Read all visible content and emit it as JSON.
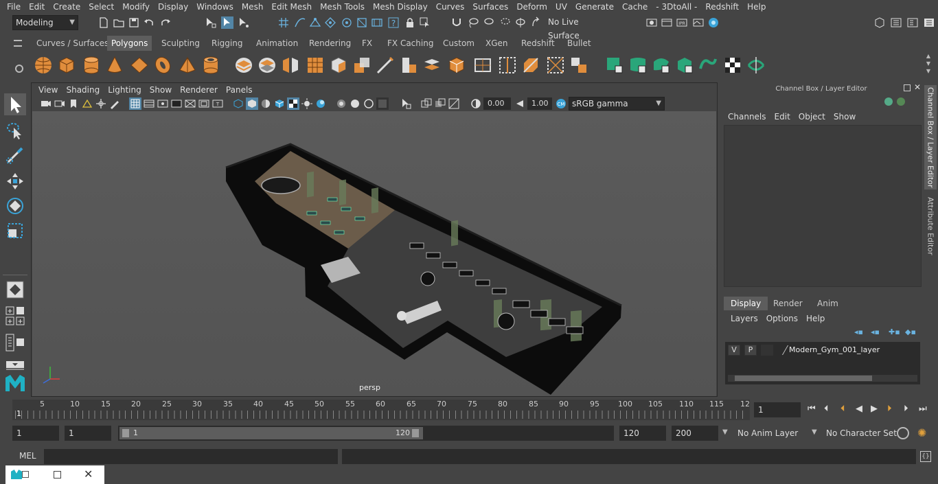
{
  "menubar": {
    "items": [
      "File",
      "Edit",
      "Create",
      "Select",
      "Modify",
      "Display",
      "Windows",
      "Mesh",
      "Edit Mesh",
      "Mesh Tools",
      "Mesh Display",
      "Curves",
      "Surfaces",
      "Deform",
      "UV",
      "Generate",
      "Cache",
      "- 3DtoAll -",
      "Redshift",
      "Help"
    ]
  },
  "statusline": {
    "mode": "Modeling",
    "live_surface": "No Live Surface"
  },
  "shelf": {
    "tabs": [
      "Curves / Surfaces",
      "Polygons",
      "Sculpting",
      "Rigging",
      "Animation",
      "Rendering",
      "FX",
      "FX Caching",
      "Custom",
      "XGen",
      "Redshift",
      "Bullet"
    ],
    "active_tab": "Polygons"
  },
  "viewport": {
    "menu": [
      "View",
      "Shading",
      "Lighting",
      "Show",
      "Renderer",
      "Panels"
    ],
    "exposure": "0.00",
    "gamma": "1.00",
    "color_space": "sRGB gamma",
    "camera_label": "persp"
  },
  "channel_box": {
    "title": "Channel Box / Layer Editor",
    "menu": [
      "Channels",
      "Edit",
      "Object",
      "Show"
    ],
    "layer_tabs": [
      "Display",
      "Render",
      "Anim"
    ],
    "active_layer_tab": "Display",
    "layer_menu": [
      "Layers",
      "Options",
      "Help"
    ],
    "layer": {
      "v": "V",
      "p": "P",
      "name": "Modern_Gym_001_layer"
    }
  },
  "side_tabs": {
    "channel_box": "Channel Box / Layer Editor",
    "attribute_editor": "Attribute Editor"
  },
  "timeline": {
    "ticks": [
      "5",
      "10",
      "15",
      "20",
      "25",
      "30",
      "35",
      "40",
      "45",
      "50",
      "55",
      "60",
      "65",
      "70",
      "75",
      "80",
      "85",
      "90",
      "95",
      "100",
      "105",
      "110",
      "115",
      "12"
    ],
    "start_marker": "1",
    "current_frame": "1"
  },
  "range": {
    "start": "1",
    "playback_start": "1",
    "slider_start": "1",
    "slider_end": "120",
    "playback_end": "120",
    "end": "200",
    "anim_layer": "No Anim Layer",
    "character_set": "No Character Set"
  },
  "command_line": {
    "label": "MEL"
  }
}
